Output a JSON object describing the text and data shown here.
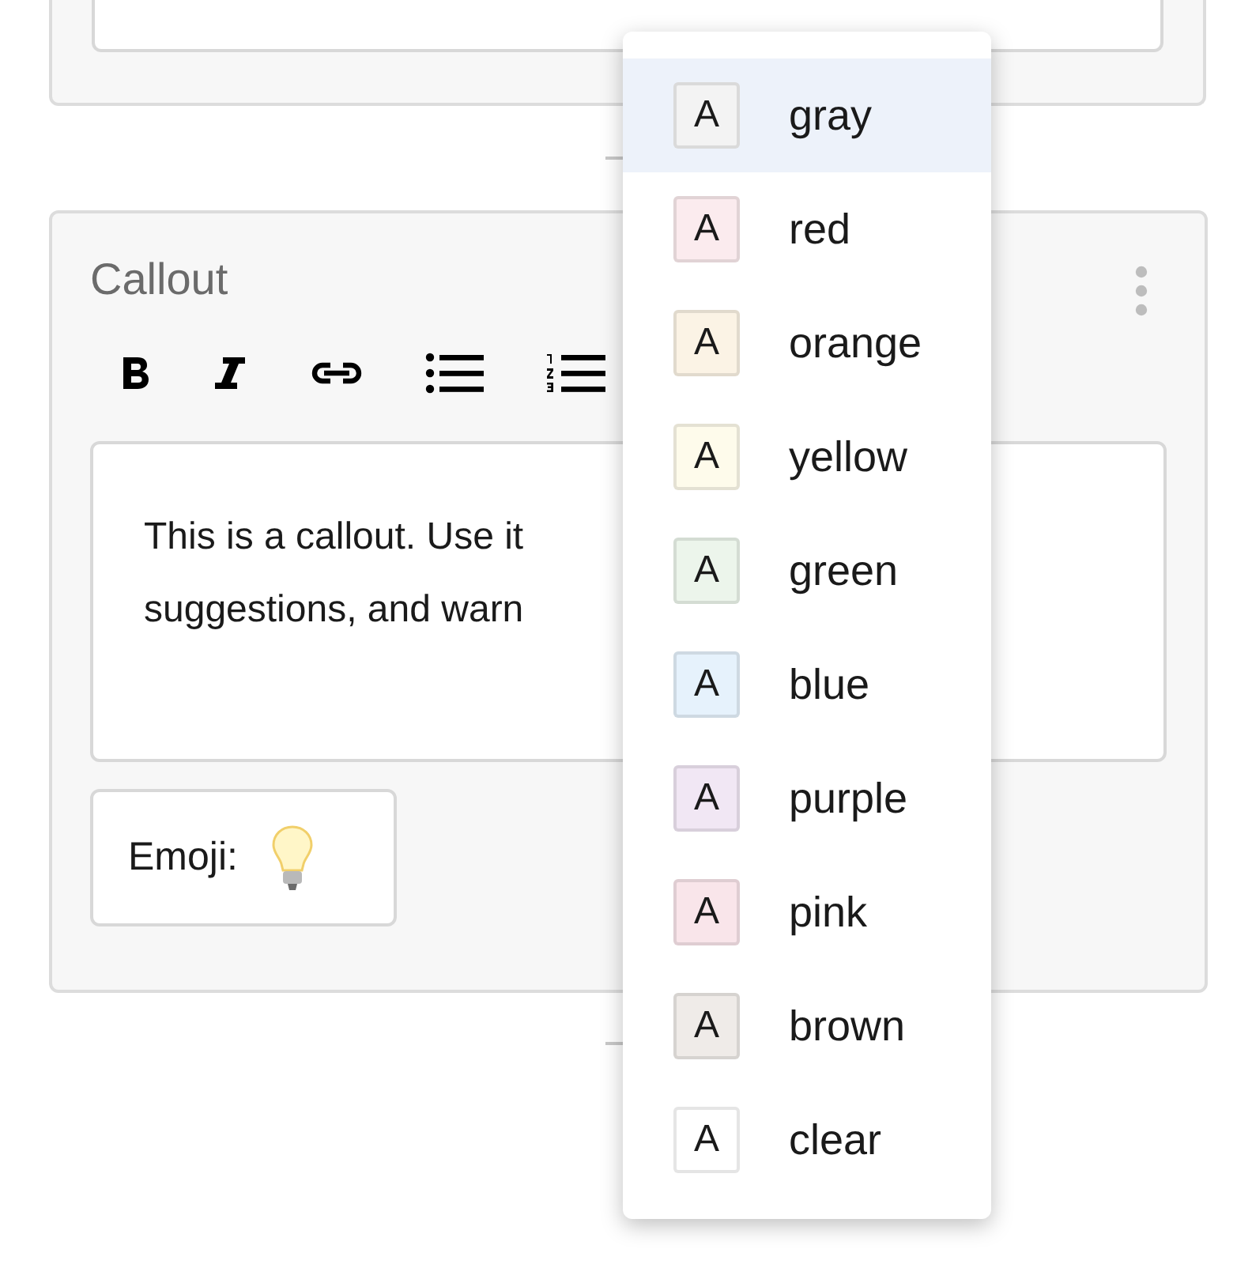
{
  "callout_block": {
    "title": "Callout",
    "toolbar": [
      {
        "kind": "bold"
      },
      {
        "kind": "italic"
      },
      {
        "kind": "link"
      },
      {
        "kind": "bullets"
      },
      {
        "kind": "numbers"
      }
    ],
    "text_lines": [
      "This is a callout. Use it",
      "suggestions, and warn"
    ],
    "emoji_label": "Emoji:"
  },
  "color_menu": [
    {
      "swatch": "A",
      "label": "gray",
      "color": "#f3f3f3",
      "selected": true
    },
    {
      "swatch": "A",
      "label": "red",
      "color": "#fbebee",
      "selected": false
    },
    {
      "swatch": "A",
      "label": "orange",
      "color": "#fbf3e5",
      "selected": false
    },
    {
      "swatch": "A",
      "label": "yellow",
      "color": "#fefbeb",
      "selected": false
    },
    {
      "swatch": "A",
      "label": "green",
      "color": "#ecf5eb",
      "selected": false
    },
    {
      "swatch": "A",
      "label": "blue",
      "color": "#e6f2fc",
      "selected": false
    },
    {
      "swatch": "A",
      "label": "purple",
      "color": "#f1e7f4",
      "selected": false
    },
    {
      "swatch": "A",
      "label": "pink",
      "color": "#f9e5ea",
      "selected": false
    },
    {
      "swatch": "A",
      "label": "brown",
      "color": "#efebe8",
      "selected": false
    },
    {
      "swatch": "A",
      "label": "clear",
      "color": "#ffffff",
      "selected": false
    }
  ]
}
